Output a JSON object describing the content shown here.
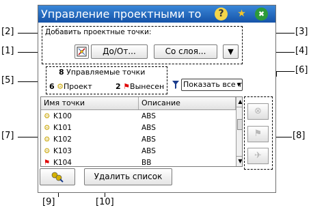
{
  "window": {
    "title": "Управление проектными то",
    "help_glyph": "?",
    "favorite_glyph": "★",
    "close_glyph": "✖"
  },
  "add_points": {
    "label": "Добавить проектные точки:",
    "from_to_button": "До/От...",
    "from_layer_button": "Со слоя...",
    "dropdown_glyph": "▼"
  },
  "managed_points": {
    "count": "8",
    "label": "Управляемые точки",
    "project_count": "6",
    "project_label": "Проект",
    "stakeout_count": "2",
    "stakeout_label": "Вынесен"
  },
  "filter": {
    "selected": "Показать все точ",
    "arrow": "▾"
  },
  "table": {
    "columns": [
      "Имя точки",
      "Описание"
    ],
    "rows": [
      {
        "name": "K100",
        "description": "ABS"
      },
      {
        "name": "K101",
        "description": "ABS"
      },
      {
        "name": "K102",
        "description": "ABS"
      },
      {
        "name": "K103",
        "description": "ABS"
      },
      {
        "name": "K104",
        "description": "BB"
      }
    ]
  },
  "bottom": {
    "delete_list_button": "Удалить список"
  },
  "callouts": {
    "c1": "[1]",
    "c2": "[2]",
    "c3": "[3]",
    "c4": "[4]",
    "c5": "[5]",
    "c6": "[6]",
    "c7": "[7]",
    "c8": "[8]",
    "c9": "[9]",
    "c10": "[10]"
  },
  "colors": {
    "title_bar": "#1f63b8",
    "project_icon": "#d4b100",
    "stakeout_flag": "#e00000"
  }
}
